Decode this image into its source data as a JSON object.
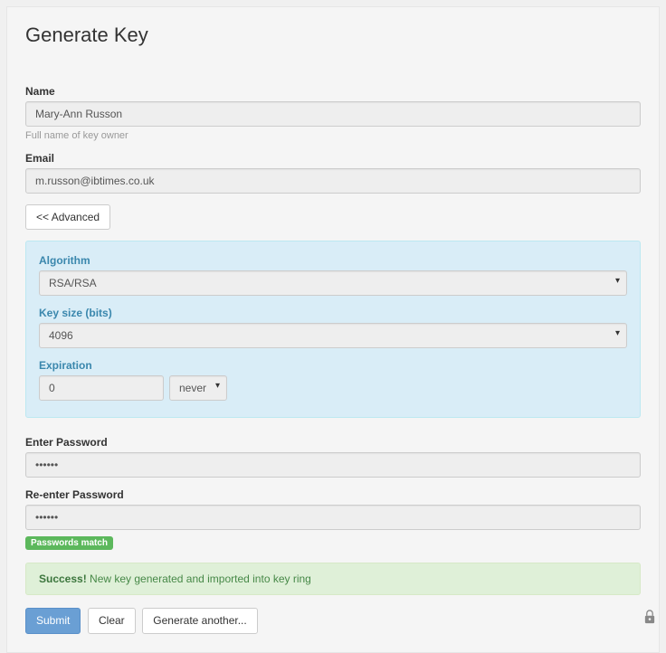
{
  "title": "Generate Key",
  "name": {
    "label": "Name",
    "value": "Mary-Ann Russon",
    "help": "Full name of key owner"
  },
  "email": {
    "label": "Email",
    "value": "m.russon@ibtimes.co.uk"
  },
  "advanced_toggle": "<< Advanced",
  "advanced": {
    "algorithm": {
      "label": "Algorithm",
      "value": "RSA/RSA"
    },
    "keysize": {
      "label": "Key size (bits)",
      "value": "4096"
    },
    "expiration": {
      "label": "Expiration",
      "amount": "0",
      "unit": "never"
    }
  },
  "password1": {
    "label": "Enter Password",
    "value": "••••••"
  },
  "password2": {
    "label": "Re-enter Password",
    "value": "••••••"
  },
  "match_badge": "Passwords match",
  "success": {
    "strong": "Success!",
    "rest": " New key generated and imported into key ring"
  },
  "buttons": {
    "submit": "Submit",
    "clear": "Clear",
    "another": "Generate another..."
  }
}
